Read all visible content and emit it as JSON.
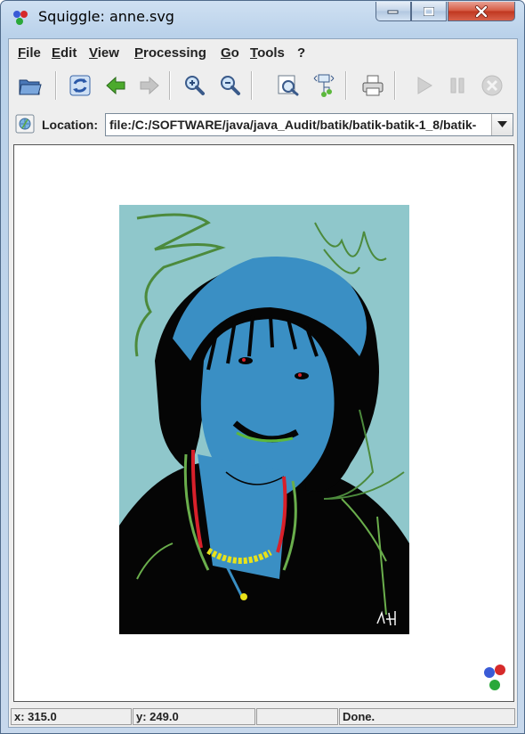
{
  "window": {
    "title": "Squiggle: anne.svg"
  },
  "menu": {
    "items": [
      {
        "label": "File"
      },
      {
        "label": "Edit"
      },
      {
        "label": "View"
      },
      {
        "label": "Processing"
      },
      {
        "label": "Go"
      },
      {
        "label": "Tools"
      },
      {
        "label": "?"
      }
    ]
  },
  "toolbar": {
    "buttons": [
      {
        "icon": "open-folder-icon",
        "enabled": true
      },
      {
        "icon": "reload-icon",
        "enabled": true
      },
      {
        "icon": "back-arrow-icon",
        "enabled": true
      },
      {
        "icon": "forward-arrow-icon",
        "enabled": false
      },
      {
        "icon": "zoom-in-icon",
        "enabled": true
      },
      {
        "icon": "zoom-out-icon",
        "enabled": true
      },
      {
        "icon": "magnifier-icon",
        "enabled": true
      },
      {
        "icon": "dom-viewer-icon",
        "enabled": true
      },
      {
        "icon": "print-icon",
        "enabled": true
      },
      {
        "icon": "play-icon",
        "enabled": false
      },
      {
        "icon": "pause-icon",
        "enabled": false
      },
      {
        "icon": "stop-icon",
        "enabled": false
      }
    ]
  },
  "location": {
    "label": "Location:",
    "value": "file:/C:/SOFTWARE/java/java_Audit/batik/batik-batik-1_8/batik-"
  },
  "status": {
    "x": "x: 315.0",
    "y": "y: 249.0",
    "message": "Done."
  },
  "colors": {
    "art_background": "#8fc7cb",
    "hair_skin_blue": "#3a8fc4",
    "squiggle_green": "#4c8a3c",
    "necklace_yellow": "#e8e21a",
    "collar_red": "#d8202a"
  }
}
